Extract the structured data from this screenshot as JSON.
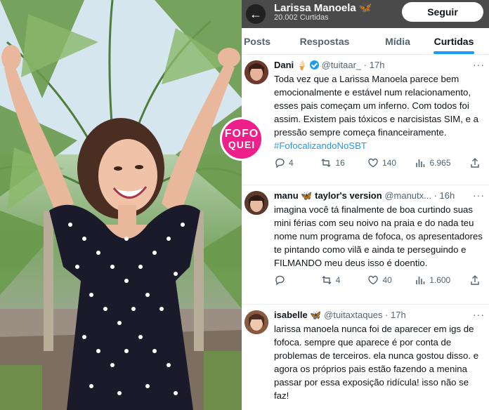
{
  "badge": {
    "line1": "FOFO",
    "line2": "QUEI"
  },
  "header": {
    "name": "Larissa Manoela",
    "name_emoji": "🦋",
    "subtitle": "20.002 Curtidas",
    "follow_label": "Seguir"
  },
  "tabs": [
    {
      "label": "Posts"
    },
    {
      "label": "Respostas"
    },
    {
      "label": "Mídia"
    },
    {
      "label": "Curtidas"
    }
  ],
  "tweets": [
    {
      "name": "Dani",
      "name_emoji": "🍦",
      "handle": "@tuitaar_",
      "time": "· 17h",
      "body": "Toda vez que a Larissa Manoela parece bem emocionalmente e estável num relacionamento, esses pais começam um inferno. Com todos foi assim. Existem pais tóxicos e narcisistas SIM, e a pressão sempre começa financeiramente.",
      "hashtag": "#FofocalizandoNoSBT",
      "replies": "4",
      "retweets": "16",
      "likes": "140",
      "views": "6.965"
    },
    {
      "name": "manu",
      "name_emoji": "🦋",
      "name_suffix": "taylor's version",
      "handle": "@manutx...",
      "time": "· 16h",
      "body": "imagina você tá finalmente de boa curtindo suas mini férias com seu noivo na praia e do nada teu nome num programa de fofoca, os apresentadores te pintando como vilã e ainda te perseguindo e FILMANDO meu deus isso é doentio.",
      "replies": "",
      "retweets": "4",
      "likes": "40",
      "views": "1.600"
    },
    {
      "name": "isabelle",
      "name_emoji": "🦋",
      "handle": "@tuitaxtaques",
      "time": "· 17h",
      "body": "larissa manoela nunca foi de aparecer em igs de fofoca. sempre que aparece é por conta de problemas de terceiros. ela nunca gostou disso. e agora os próprios pais estão fazendo a menina passar por essa exposição ridícula! isso não se faz!"
    }
  ],
  "colors": {
    "accent": "#1d9bf0",
    "badge": "#ee1e8a",
    "header_bg": "#4a4a4a"
  }
}
